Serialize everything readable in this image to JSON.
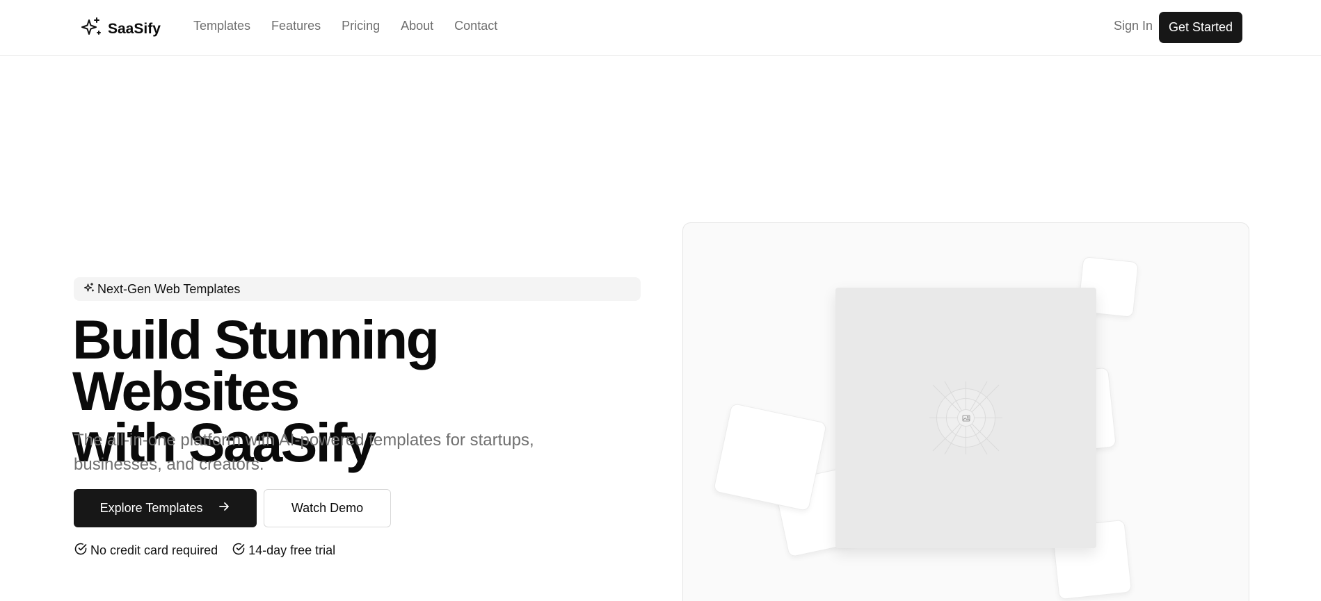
{
  "brand": {
    "name": "SaaSify",
    "icon": "sparkles-icon"
  },
  "nav": {
    "items": [
      {
        "label": "Templates"
      },
      {
        "label": "Features"
      },
      {
        "label": "Pricing"
      },
      {
        "label": "About"
      },
      {
        "label": "Contact"
      }
    ],
    "sign_in": "Sign In",
    "get_started": "Get Started"
  },
  "hero": {
    "badge": "Next-Gen Web Templates",
    "title_line1": "Build Stunning Websites",
    "title_line2": "with SaaSify",
    "subtitle": "The all-in-one platform with AI-powered templates for startups, businesses, and creators.",
    "primary_cta": "Explore Templates",
    "secondary_cta": "Watch Demo",
    "checks": [
      {
        "label": "No credit card required"
      },
      {
        "label": "14-day free trial"
      }
    ]
  },
  "colors": {
    "primary": "#171717",
    "muted_text": "#707070",
    "badge_bg": "#f4f4f4"
  }
}
